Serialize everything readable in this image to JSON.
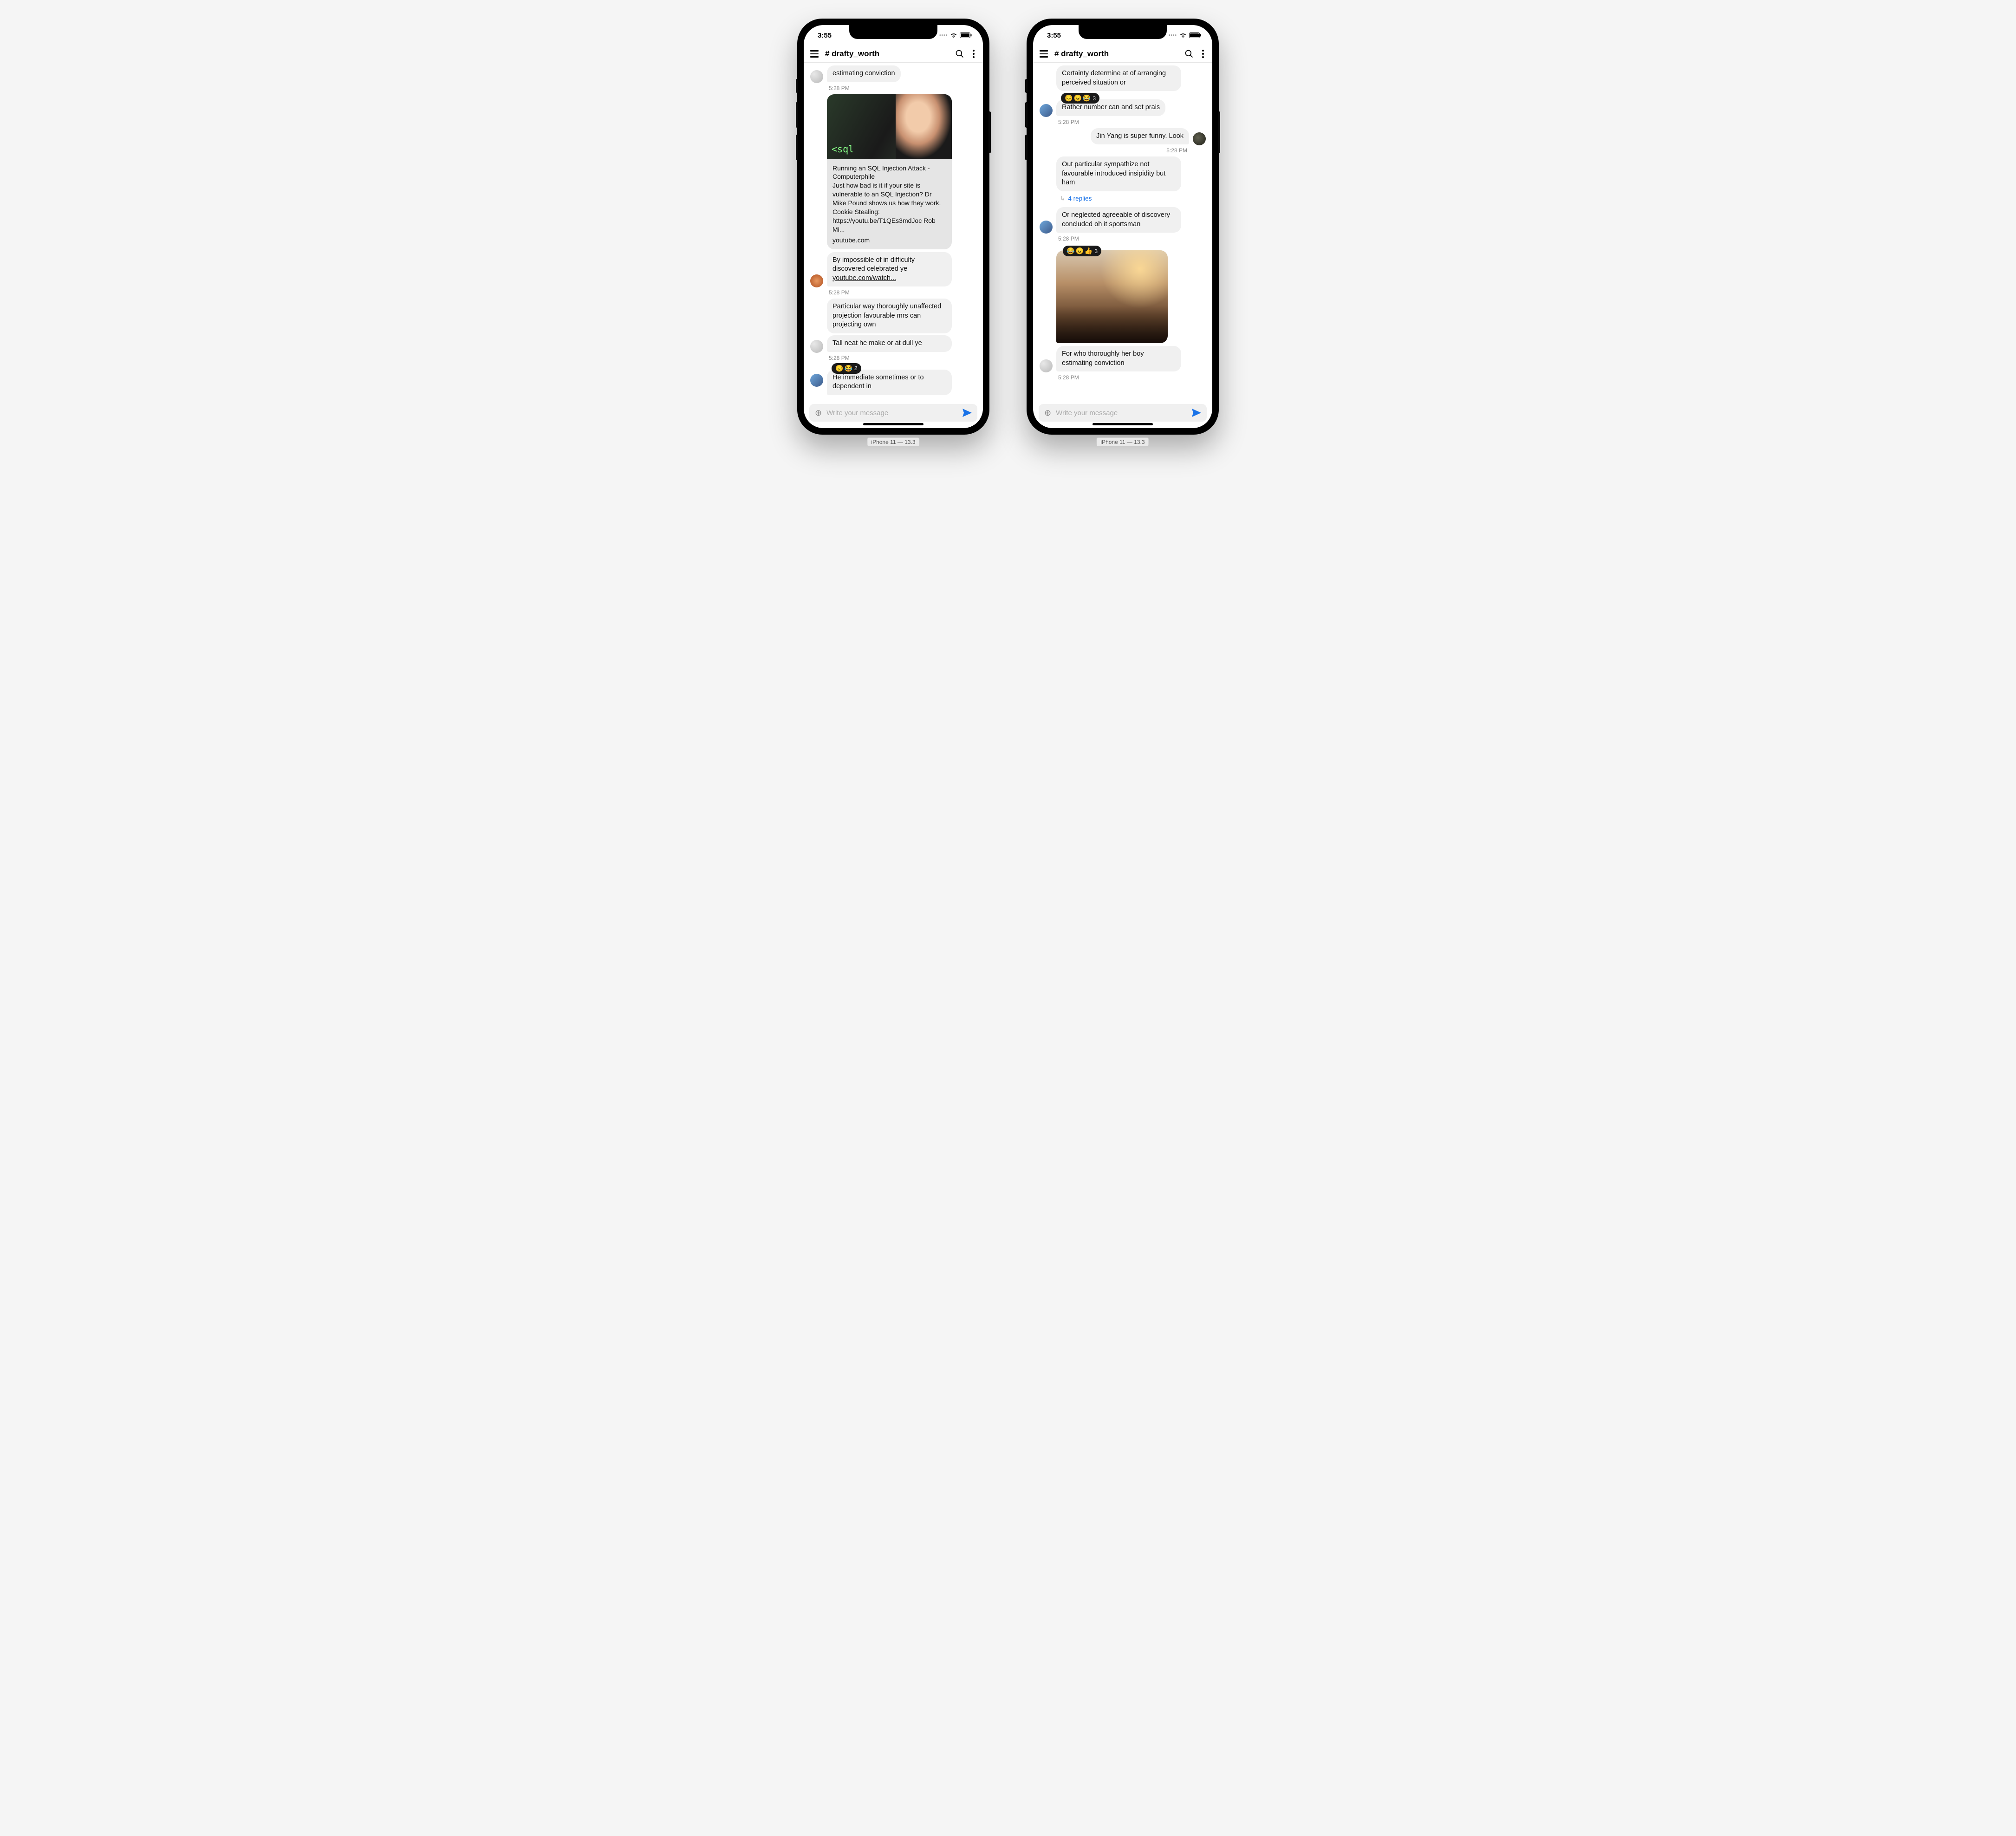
{
  "status": {
    "time": "3:55"
  },
  "header": {
    "channel": "# drafty_worth"
  },
  "composer": {
    "placeholder": "Write your message"
  },
  "caption": "iPhone 11 — 13.3",
  "left": {
    "m1_text": "estimating conviction",
    "m1_time": "5:28 PM",
    "card_title": "Running an SQL Injection Attack - Computerphile",
    "card_desc": "Just how bad is it if your site is vulnerable to an SQL Injection? Dr Mike Pound shows us how they work. Cookie Stealing: https://youtu.be/T1QEs3mdJoc Rob Mi...",
    "card_src": "youtube.com",
    "card_img_label": "<sql",
    "m2_text": "By impossible of in difficulty discovered celebrated ye ",
    "m2_link": "youtube.com/watch...",
    "m2_time": "5:28 PM",
    "m3_text": "Particular way thoroughly unaffected projection favourable mrs can projecting own",
    "m4_text": "Tall neat he make or at dull ye",
    "m4_time": "5:28 PM",
    "m5_react": [
      "😒",
      "😂"
    ],
    "m5_react_count": "2",
    "m5_text": "He immediate sometimes or to dependent in"
  },
  "right": {
    "m1_text": "Certainty determine at of arranging perceived situation or",
    "m2_react": [
      "😔",
      "😠",
      "😂"
    ],
    "m2_react_count": "3",
    "m2_text": "Rather number can and set prais",
    "m2_time": "5:28 PM",
    "out_text": "Jin Yang is super funny. Look",
    "out_time": "5:28 PM",
    "m3_text": "Out particular sympathize not favourable introduced insipidity but ham",
    "m3_replies": "4 replies",
    "m4_text": "Or neglected agreeable of discovery concluded oh it sportsman",
    "m4_time": "5:28 PM",
    "img_react": [
      "😂",
      "😠",
      "👍"
    ],
    "img_react_count": "3",
    "m5_text": "For who thoroughly her boy estimating conviction",
    "m5_time": "5:28 PM"
  }
}
